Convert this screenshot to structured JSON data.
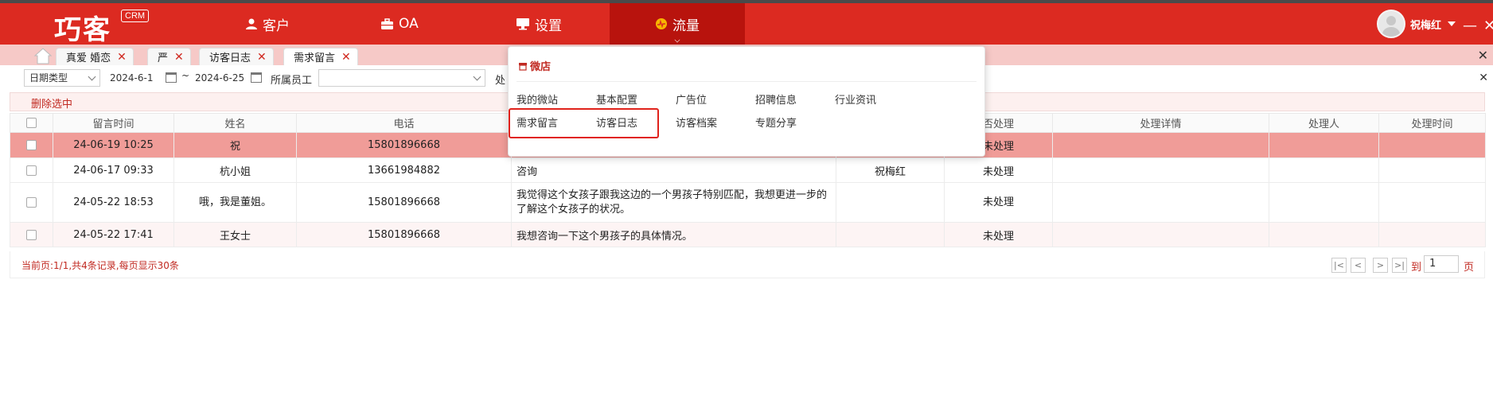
{
  "header": {
    "logo": "巧客",
    "logo_badge": "CRM",
    "nav": [
      {
        "label": "客户",
        "icon": "user-icon"
      },
      {
        "label": "OA",
        "icon": "briefcase-icon"
      },
      {
        "label": "设置",
        "icon": "monitor-icon"
      },
      {
        "label": "流量",
        "icon": "traffic-icon"
      }
    ],
    "username": "祝梅红",
    "minimize": "—",
    "close": "✕"
  },
  "tabs": [
    {
      "label": "真爱 婚恋"
    },
    {
      "label": "严"
    },
    {
      "label": "访客日志"
    },
    {
      "label": "需求留言"
    }
  ],
  "filters": {
    "date_type": "日期类型",
    "date_from": "2024-6-1",
    "tilde": "~",
    "date_to": "2024-6-25",
    "staff_label": "所属员工",
    "process_label_partial": "处"
  },
  "toolbar": {
    "delete_label": "删除选中"
  },
  "table": {
    "headers": [
      "留言时间",
      "姓名",
      "电话",
      "",
      "",
      "否处理",
      "处理详情",
      "处理人",
      "处理时间"
    ],
    "rows": [
      {
        "time": "24-06-19 10:25",
        "name": "祝",
        "phone": "15801896668",
        "content": "",
        "owner": "",
        "status": "未处理",
        "detail": "",
        "handler": "",
        "handled_at": ""
      },
      {
        "time": "24-06-17 09:33",
        "name": "杭小姐",
        "phone": "13661984882",
        "content": "咨询",
        "owner": "祝梅红",
        "status": "未处理",
        "detail": "",
        "handler": "",
        "handled_at": ""
      },
      {
        "time": "24-05-22 18:53",
        "name": "哦，我是董姐。",
        "phone": "15801896668",
        "content": "我觉得这个女孩子跟我这边的一个男孩子特别匹配，我想更进一步的了解这个女孩子的状况。",
        "owner": "",
        "status": "未处理",
        "detail": "",
        "handler": "",
        "handled_at": ""
      },
      {
        "time": "24-05-22 17:41",
        "name": "王女士",
        "phone": "15801896668",
        "content": "我想咨询一下这个男孩子的具体情况。",
        "owner": "",
        "status": "未处理",
        "detail": "",
        "handler": "",
        "handled_at": ""
      }
    ]
  },
  "pagination": {
    "info": "当前页:1/1,共4条记录,每页显示30条",
    "first": "|<",
    "prev": "<",
    "next": ">",
    "last": ">|",
    "goto_label": "到",
    "page_value": "1",
    "page_unit": "页"
  },
  "dropdown": {
    "section": "微店",
    "items_row1": [
      "我的微站",
      "基本配置",
      "广告位",
      "招聘信息",
      "行业资讯"
    ],
    "items_row2": [
      "需求留言",
      "访客日志",
      "访客档案",
      "专题分享"
    ]
  },
  "colors": {
    "brand": "#dc2a21",
    "nav_active": "#b8130d",
    "tabbar": "#f6c9c7",
    "selected_row": "#f09c98"
  }
}
